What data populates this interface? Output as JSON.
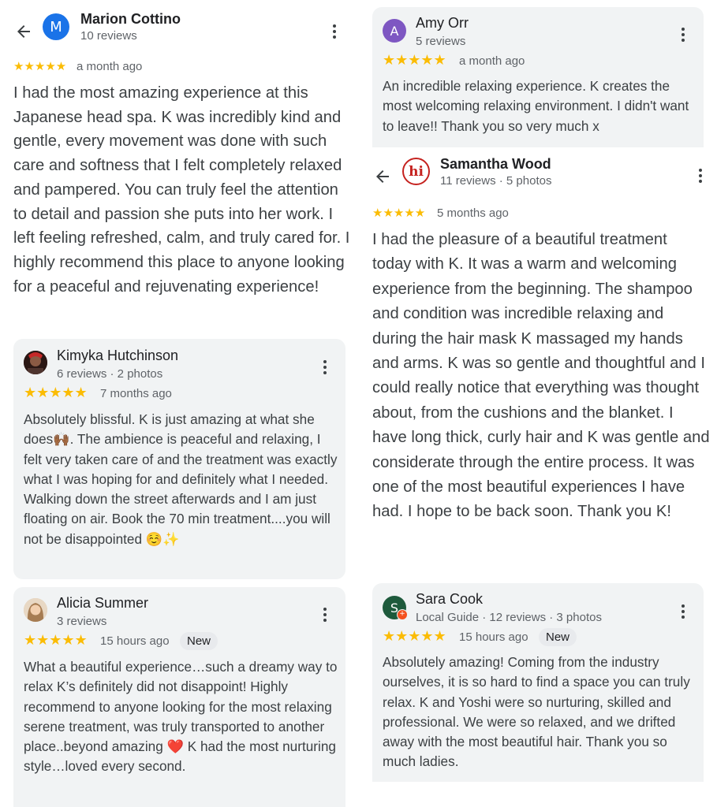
{
  "colors": {
    "star": "#fbbc04",
    "card_bg": "#f1f3f4",
    "avatar_m": "#1a73e8",
    "avatar_a": "#7e57c2",
    "avatar_s": "#1e5a3c",
    "avatar_hi": "#c5221f"
  },
  "reviews": {
    "marion": {
      "initial": "M",
      "name": "Marion Cottino",
      "meta": "10 reviews",
      "stars": "★★★★★",
      "when": "a month ago",
      "text": "I had the most amazing experience at this Japanese head spa. K was incredibly kind and gentle, every movement was done with such care and softness that I felt completely relaxed and pampered. You can truly feel the attention to detail and passion she puts into her work. I left feeling refreshed, calm, and truly cared for. I highly recommend this place to anyone looking for a peaceful and rejuvenating experience!"
    },
    "kimyka": {
      "name": "Kimyka Hutchinson",
      "meta": "6 reviews · 2 photos",
      "stars": "★★★★★",
      "when": "7 months ago",
      "text": "Absolutely blissful. K is just amazing at what she does🙌🏾. The ambience is peaceful and relaxing, I felt very taken care of and the treatment was exactly what I was hoping for and definitely what I needed. Walking down the street afterwards and I am just floating on air. Book the 70 min treatment....you will not be disappointed ☺️✨"
    },
    "alicia": {
      "name": "Alicia Summer",
      "meta": "3 reviews",
      "stars": "★★★★★",
      "when": "15 hours ago",
      "badge": "New",
      "text": "What a beautiful experience…such a dreamy way to relax K’s definitely did not disappoint! Highly recommend to anyone looking for the most relaxing serene treatment, was truly transported to another place..beyond amazing ❤️ K had the most nurturing style…loved every second."
    },
    "amy": {
      "initial": "A",
      "name": "Amy Orr",
      "meta": "5 reviews",
      "stars": "★★★★★",
      "when": "a month ago",
      "text": "An incredible relaxing experience. K creates the most welcoming relaxing environment. I didn't want to leave!! Thank you so very much x"
    },
    "samantha": {
      "logo": "hi",
      "name": "Samantha Wood",
      "meta": "11 reviews · 5 photos",
      "stars": "★★★★★",
      "when": "5 months ago",
      "text": "I had the pleasure of a beautiful treatment today with K. It was a warm and welcoming experience from the beginning. The shampoo and condition was incredible relaxing and during the hair mask K massaged my hands and arms. K was so gentle and thoughtful and I could really notice that everything was thought about, from the cushions and the blanket. I have long thick, curly hair and K was gentle and considerate through the entire process. It was one of the most beautiful experiences I have had. I hope to be back soon. Thank you K!"
    },
    "sara": {
      "initial": "S",
      "name": "Sara Cook",
      "meta": "Local Guide · 12 reviews · 3 photos",
      "stars": "★★★★★",
      "when": "15 hours ago",
      "badge": "New",
      "text": "Absolutely amazing! Coming from the industry ourselves, it is so hard to find a space you can truly relax. K and Yoshi were so nurturing, skilled and professional. We were so relaxed, and we drifted away with the most beautiful hair. Thank you so much ladies."
    }
  }
}
